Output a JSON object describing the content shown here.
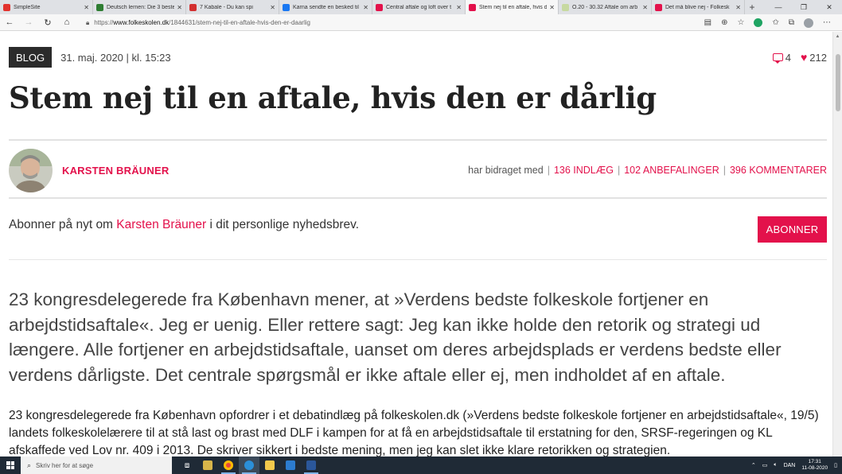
{
  "browser": {
    "tabs": [
      {
        "title": "SimpleSite",
        "color": "#e2322d",
        "active": false
      },
      {
        "title": "Deutsch lernen: Die 3 beste",
        "color": "#2e7d32",
        "active": false
      },
      {
        "title": "7 Kabale - Du kan spi",
        "color": "#d32f2f",
        "active": false
      },
      {
        "title": "Karna sendte en besked til",
        "color": "#1877f2",
        "active": false
      },
      {
        "title": "Central aftale og loft over t",
        "color": "#e3114b",
        "active": false
      },
      {
        "title": "Stem nej til en aftale, hvis d",
        "color": "#e3114b",
        "active": true
      },
      {
        "title": "O.20 - 30.32 Aftale om arb",
        "color": "#c7d9a0",
        "active": false
      },
      {
        "title": "Det må blive nej - Folkesk",
        "color": "#e3114b",
        "active": false
      }
    ],
    "url_prefix": "https://",
    "url_host": "www.folkeskolen.dk",
    "url_path": "/1844631/stem-nej-til-en-aftale-hvis-den-er-daarlig"
  },
  "article": {
    "badge": "BLOG",
    "date": "31. maj. 2020 | kl. 15:23",
    "comment_count": "4",
    "like_count": "212",
    "title": "Stem nej til en aftale, hvis den er dårlig",
    "author_name": "KARSTEN BRÄUNER",
    "contrib_label": "har bidraget med",
    "contrib_posts": "136 INDLÆG",
    "contrib_recommendations": "102 ANBEFALINGER",
    "contrib_comments": "396 KOMMENTARER",
    "subscribe_prefix": "Abonner på nyt om ",
    "subscribe_name": "Karsten Bräuner",
    "subscribe_suffix": " i dit personlige nyhedsbrev.",
    "subscribe_button": "ABONNER",
    "lead": "23 kongresdelegerede fra København mener, at »Verdens bedste folkeskole fortjener en arbejdstidsaftale«. Jeg er uenig. Eller rettere sagt: Jeg kan ikke holde den retorik og strategi ud længere. Alle fortjener en arbejdstidsaftale, uanset om deres arbejdsplads er verdens bedste eller verdens dårligste. Det centrale spørgsmål er ikke aftale eller ej, men indholdet af en aftale.",
    "body": "23 kongresdelegerede fra København opfordrer i et debatindlæg på folkeskolen.dk (»Verdens bedste folkeskole fortjener en arbejdstidsaftale«, 19/5) landets folkeskolelærere til at stå last og brast med DLF i kampen for at få en arbejdstidsaftale til erstatning for den, SRSF-regeringen og KL afskaffede ved Lov nr. 409 i 2013. De skriver sikkert i bedste mening, men jeg kan slet ikke klare retorikken og strategien."
  },
  "taskbar": {
    "search_placeholder": "Skriv her for at søge",
    "language": "DAN",
    "time": "17:31",
    "date": "11-08-2020"
  },
  "colors": {
    "accent": "#e3114b",
    "badge_bg": "#2b2b2b",
    "taskbar_bg": "#1f2a36"
  }
}
